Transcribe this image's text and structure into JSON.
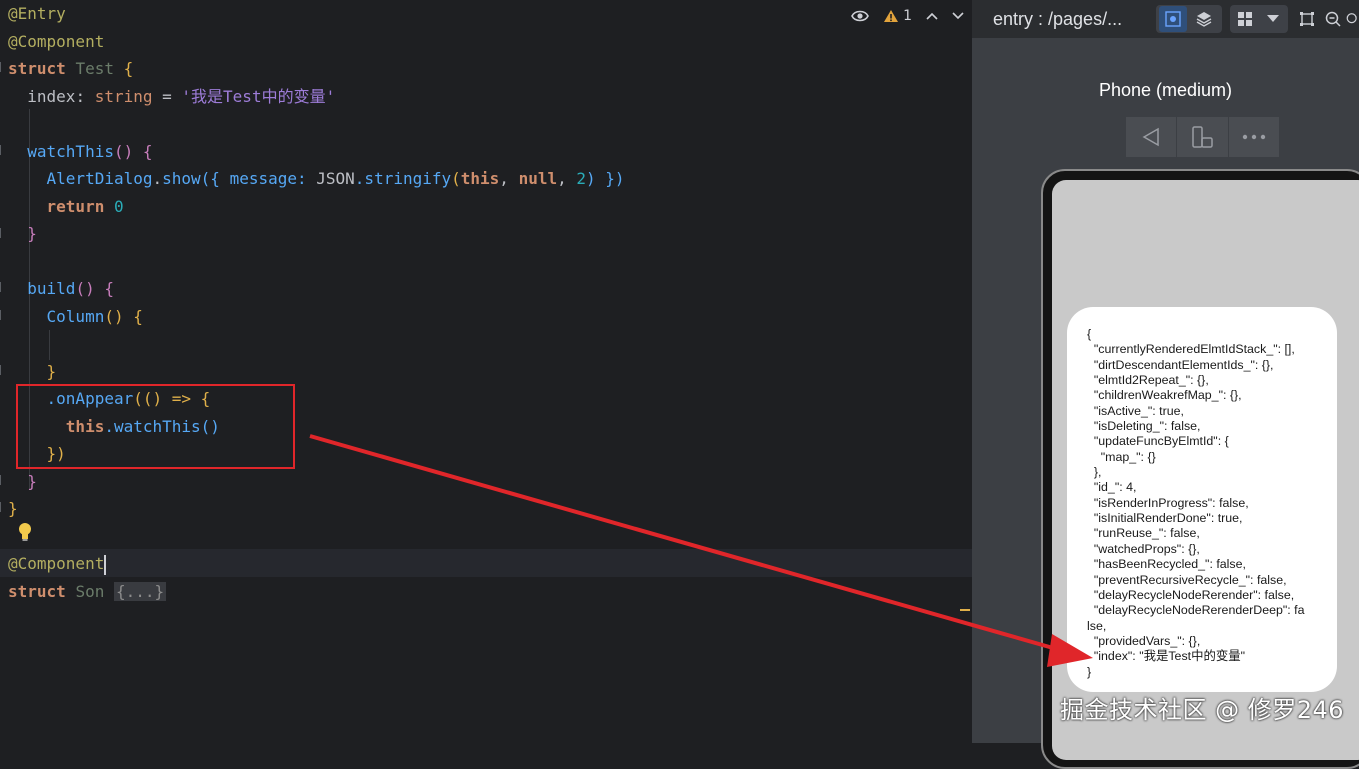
{
  "editor": {
    "line_entry": "@Entry",
    "line_component": "@Component",
    "kw_struct": "struct",
    "test_name": "Test",
    "brace_open": "{",
    "index_prop": "index",
    "index_colon": ": ",
    "index_type": "string",
    "index_eq": " = ",
    "index_value": "'我是Test中的变量'",
    "watch_fn": "watchThis",
    "parens_open": "() {",
    "alert_cls": "AlertDialog",
    "dot_show": ".",
    "show_fn": "show",
    "alert_open": "({ message: ",
    "json_cls": "JSON",
    "stringify_fn": ".stringify",
    "paren_open": "(",
    "kw_this": "this",
    "comma": ", ",
    "kw_null": "null",
    "num_2": "2",
    "alert_close": ") })",
    "kw_return": "return",
    "num_0": "0",
    "brace_close": "}",
    "build_fn": "build",
    "column_fn": "Column",
    "on_appear": ".onAppear",
    "arrow_open": "(() => {",
    "call_watch": ".watchThis",
    "call_parens": "()",
    "close_paren_brace": "})",
    "component2": "@Component",
    "son_name": "Son",
    "folded": "{...}",
    "warning_count": "1"
  },
  "preview": {
    "title": "entry : /pages/...",
    "device_name": "Phone (medium)",
    "dialog_lines": [
      "{",
      "  \"currentlyRenderedElmtIdStack_\": [],",
      "  \"dirtDescendantElementIds_\": {},",
      "  \"elmtId2Repeat_\": {},",
      "  \"childrenWeakrefMap_\": {},",
      "  \"isActive_\": true,",
      "  \"isDeleting_\": false,",
      "  \"updateFuncByElmtId\": {",
      "    \"map_\": {}",
      "  },",
      "  \"id_\": 4,",
      "  \"isRenderInProgress\": false,",
      "  \"isInitialRenderDone\": true,",
      "  \"runReuse_\": false,",
      "  \"watchedProps\": {},",
      "  \"hasBeenRecycled_\": false,",
      "  \"preventRecursiveRecycle_\": false,",
      "  \"delayRecycleNodeRerender\": false,",
      "  \"delayRecycleNodeRerenderDeep\": fa",
      "lse,",
      "  \"providedVars_\": {},",
      "  \"index\": \"我是Test中的变量\"",
      "}"
    ],
    "watermark": "掘金技术社区 @ 修罗246"
  },
  "colors": {
    "editor_bg": "#1e1f22",
    "preview_bg": "#3c3f44",
    "annotation_red": "#e0262a"
  }
}
